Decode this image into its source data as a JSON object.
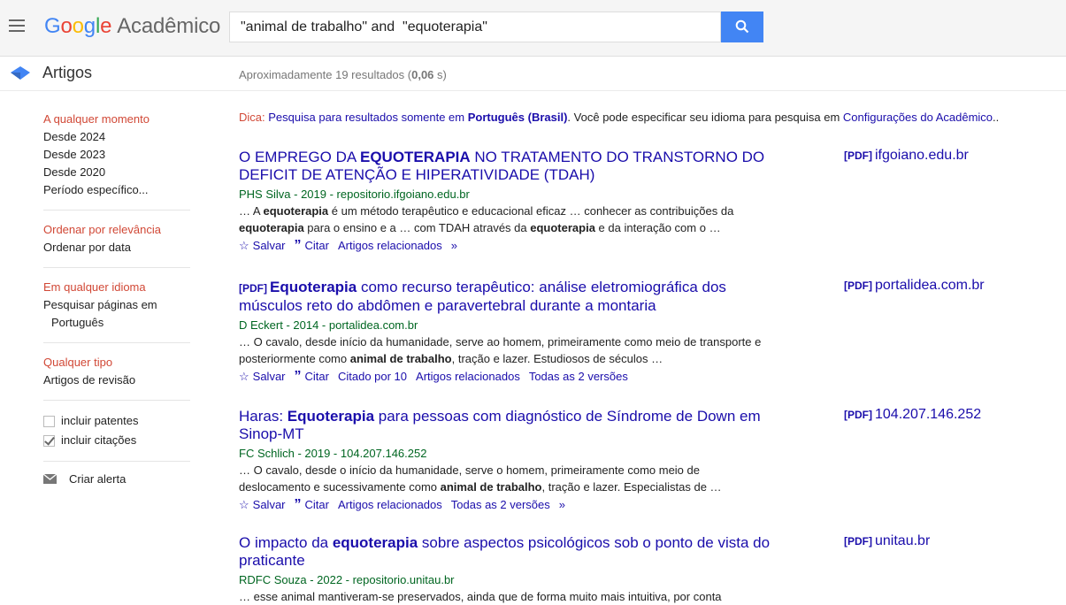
{
  "header": {
    "logo_google": [
      "G",
      "o",
      "o",
      "g",
      "l",
      "e"
    ],
    "logo_suffix": "Acadêmico",
    "search_value": "\"animal de trabalho\" and  \"equoterapia\""
  },
  "subheader": {
    "title": "Artigos",
    "count_prefix": "Aproximadamente 19 resultados (",
    "count_time": "0,06",
    "count_suffix": " s)"
  },
  "sidebar": {
    "time": {
      "selected": "A qualquer momento",
      "items": [
        "Desde 2024",
        "Desde 2023",
        "Desde 2020",
        "Período específico..."
      ]
    },
    "sort": {
      "selected": "Ordenar por relevância",
      "items": [
        "Ordenar por data"
      ]
    },
    "lang": {
      "selected": "Em qualquer idioma",
      "items": [
        "Pesquisar páginas em Português"
      ]
    },
    "type": {
      "selected": "Qualquer tipo",
      "items": [
        "Artigos de revisão"
      ]
    },
    "checkboxes": [
      {
        "label": "incluir patentes",
        "checked": false
      },
      {
        "label": "incluir citações",
        "checked": true
      }
    ],
    "alert_label": "Criar alerta"
  },
  "tip": {
    "prefix": "Dica:",
    "text1": "Pesquisa para resultados somente em",
    "lang": "Português (Brasil)",
    "text2": "Você pode especificar seu idioma para pesquisa em",
    "link": "Configurações do Acadêmico",
    "end": ".."
  },
  "results": [
    {
      "title_parts": [
        {
          "t": "O EMPREGO DA ",
          "b": false
        },
        {
          "t": "EQUOTERAPIA",
          "b": true
        },
        {
          "t": " NO TRATAMENTO DO TRANSTORNO DO DEFICIT DE ATENÇÃO E HIPERATIVIDADE (TDAH)",
          "b": false
        }
      ],
      "pdf_prefix": false,
      "authors": "PHS Silva - 2019 - repositorio.ifgoiano.edu.br",
      "snippet_parts": [
        {
          "t": "… A ",
          "b": false
        },
        {
          "t": "equoterapia",
          "b": true
        },
        {
          "t": " é um método terapêutico e educacional eficaz … conhecer as contribuições da ",
          "b": false
        },
        {
          "t": "equoterapia",
          "b": true
        },
        {
          "t": " para o ensino e a … com TDAH através da ",
          "b": false
        },
        {
          "t": "equoterapia",
          "b": true
        },
        {
          "t": " e da interação com o …",
          "b": false
        }
      ],
      "actions": [
        "Salvar",
        "Citar",
        "Artigos relacionados"
      ],
      "has_more_icon": true,
      "side_tag": "[PDF]",
      "side_domain": "ifgoiano.edu.br"
    },
    {
      "title_parts": [
        {
          "t": "Equoterapia",
          "b": true
        },
        {
          "t": " como recurso terapêutico: análise eletromiográfica dos músculos reto do abdômen e paravertebral durante a montaria",
          "b": false
        }
      ],
      "pdf_prefix": true,
      "authors": "D Eckert - 2014 - portalidea.com.br",
      "snippet_parts": [
        {
          "t": "… O cavalo, desde início da humanidade, serve ao homem, primeiramente como meio de transporte e posteriormente como ",
          "b": false
        },
        {
          "t": "animal de trabalho",
          "b": true
        },
        {
          "t": ", tração e lazer. Estudiosos de séculos …",
          "b": false
        }
      ],
      "actions": [
        "Salvar",
        "Citar",
        "Citado por 10",
        "Artigos relacionados",
        "Todas as 2 versões"
      ],
      "has_more_icon": false,
      "side_tag": "[PDF]",
      "side_domain": "portalidea.com.br"
    },
    {
      "title_parts": [
        {
          "t": "Haras: ",
          "b": false
        },
        {
          "t": "Equoterapia",
          "b": true
        },
        {
          "t": " para pessoas com diagnóstico de Síndrome de Down em Sinop-MT",
          "b": false
        }
      ],
      "pdf_prefix": false,
      "authors": "FC Schlich - 2019 - 104.207.146.252",
      "snippet_parts": [
        {
          "t": "… O cavalo, desde o início da humanidade, serve o homem, primeiramente como meio de deslocamento e sucessivamente como ",
          "b": false
        },
        {
          "t": "animal de trabalho",
          "b": true
        },
        {
          "t": ", tração e lazer. Especialistas de …",
          "b": false
        }
      ],
      "actions": [
        "Salvar",
        "Citar",
        "Artigos relacionados",
        "Todas as 2 versões"
      ],
      "has_more_icon": true,
      "side_tag": "[PDF]",
      "side_domain": "104.207.146.252"
    },
    {
      "title_parts": [
        {
          "t": "O impacto da ",
          "b": false
        },
        {
          "t": "equoterapia",
          "b": true
        },
        {
          "t": " sobre aspectos psicológicos sob o ponto de vista do praticante",
          "b": false
        }
      ],
      "pdf_prefix": false,
      "authors": "RDFC Souza - 2022 - repositorio.unitau.br",
      "snippet_parts": [
        {
          "t": "… esse animal mantiveram-se preservados, ainda que de forma muito mais intuitiva, por conta",
          "b": false
        }
      ],
      "actions": [],
      "has_more_icon": false,
      "side_tag": "[PDF]",
      "side_domain": "unitau.br"
    }
  ],
  "pdf_label": "[PDF]",
  "colors": {
    "link": "#1a0dab",
    "green": "#006621",
    "red": "#d14836",
    "search_blue": "#4285f4"
  }
}
